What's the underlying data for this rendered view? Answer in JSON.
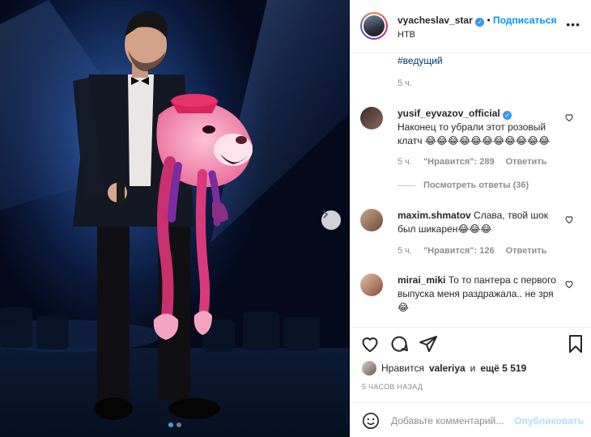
{
  "header": {
    "username": "vyacheslav_star",
    "follow_label": "Подписаться",
    "location": "НТВ",
    "more_icon": "more-options-icon"
  },
  "caption": {
    "hashtag": "#ведущий",
    "time": "5 ч."
  },
  "comments": [
    {
      "username": "yusif_eyvazov_official",
      "verified": true,
      "text": "Наконец то убрали этот розовый клатч 😂😂😂😂😂😂😂😂😂😂😂",
      "time": "5 ч.",
      "likes": "\"Нравится\": 289",
      "reply": "Ответить",
      "view_replies": "Посмотреть ответы (36)"
    },
    {
      "username": "maxim.shmatov",
      "text": "Слава, твой шок был шикарен😂😂😂",
      "time": "5 ч.",
      "likes": "\"Нравится\": 126",
      "reply": "Ответить"
    },
    {
      "username": "mirai_miki",
      "text": "То то пантера с первого выпуска меня раздражала.. не зря😂"
    }
  ],
  "actions": {
    "liked_by": "Нравится valeriya и ещё 5 519",
    "liked_user": "valeriya",
    "likes_rest": "ещё 5 519",
    "likes_prefix": "Нравится",
    "likes_and": "и",
    "post_time": "5 ЧАСОВ НАЗАД",
    "comment_placeholder": "Добавьте комментарий...",
    "publish_label": "Опубликовать"
  },
  "carousel": {
    "current": 1,
    "total": 2
  },
  "colors": {
    "link": "#0095f6",
    "accent_dot": "#3aa0ef",
    "publish_disabled": "#b2dffc"
  }
}
